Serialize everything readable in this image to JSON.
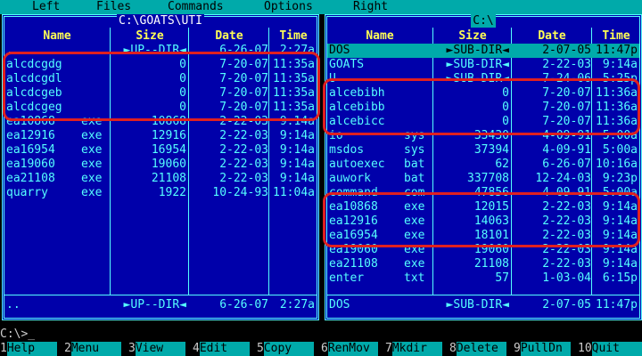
{
  "menu": [
    "Left",
    "Files",
    "Commands",
    "Options",
    "Right"
  ],
  "left_panel": {
    "title": "C:\\GOATS\\UTI",
    "headers": {
      "name": "Name",
      "size": "Size",
      "date": "Date",
      "time": "Time"
    },
    "rows": [
      {
        "name": "..",
        "ext": "",
        "size": "►UP--DIR◄",
        "date": "6-26-07",
        "time": "2:27a",
        "selected": false
      },
      {
        "name": "alcdcgdg",
        "ext": "",
        "size": "0",
        "date": "7-20-07",
        "time": "11:35a",
        "selected": false
      },
      {
        "name": "alcdcgdl",
        "ext": "",
        "size": "0",
        "date": "7-20-07",
        "time": "11:35a",
        "selected": false
      },
      {
        "name": "alcdcgeb",
        "ext": "",
        "size": "0",
        "date": "7-20-07",
        "time": "11:35a",
        "selected": false
      },
      {
        "name": "alcdcgeg",
        "ext": "",
        "size": "0",
        "date": "7-20-07",
        "time": "11:35a",
        "selected": false
      },
      {
        "name": "ea10868",
        "ext": "exe",
        "size": "10868",
        "date": "2-22-03",
        "time": "9:14a",
        "selected": false
      },
      {
        "name": "ea12916",
        "ext": "exe",
        "size": "12916",
        "date": "2-22-03",
        "time": "9:14a",
        "selected": false
      },
      {
        "name": "ea16954",
        "ext": "exe",
        "size": "16954",
        "date": "2-22-03",
        "time": "9:14a",
        "selected": false
      },
      {
        "name": "ea19060",
        "ext": "exe",
        "size": "19060",
        "date": "2-22-03",
        "time": "9:14a",
        "selected": false
      },
      {
        "name": "ea21108",
        "ext": "exe",
        "size": "21108",
        "date": "2-22-03",
        "time": "9:14a",
        "selected": false
      },
      {
        "name": "quarry",
        "ext": "exe",
        "size": "1922",
        "date": "10-24-93",
        "time": "11:04a",
        "selected": false
      }
    ],
    "status": {
      "name": "..",
      "size": "►UP--DIR◄",
      "date": "6-26-07",
      "time": "2:27a"
    }
  },
  "right_panel": {
    "title": "C:\\",
    "headers": {
      "name": "Name",
      "size": "Size",
      "date": "Date",
      "time": "Time"
    },
    "rows": [
      {
        "name": "DOS",
        "ext": "",
        "size": "►SUB-DIR◄",
        "date": "2-07-05",
        "time": "11:47p",
        "selected": true
      },
      {
        "name": "GOATS",
        "ext": "",
        "size": "►SUB-DIR◄",
        "date": "2-22-03",
        "time": "9:14a",
        "selected": false
      },
      {
        "name": "U",
        "ext": "",
        "size": "►SUB-DIR◄",
        "date": "7-24-06",
        "time": "5:25p",
        "selected": false
      },
      {
        "name": "alcebibh",
        "ext": "",
        "size": "0",
        "date": "7-20-07",
        "time": "11:36a",
        "selected": false
      },
      {
        "name": "alcebibb",
        "ext": "",
        "size": "0",
        "date": "7-20-07",
        "time": "11:36a",
        "selected": false
      },
      {
        "name": "alcebicc",
        "ext": "",
        "size": "0",
        "date": "7-20-07",
        "time": "11:36a",
        "selected": false
      },
      {
        "name": "io",
        "ext": "sys",
        "size": "33430",
        "date": "4-09-91",
        "time": "5:00a",
        "selected": false
      },
      {
        "name": "msdos",
        "ext": "sys",
        "size": "37394",
        "date": "4-09-91",
        "time": "5:00a",
        "selected": false
      },
      {
        "name": "autoexec",
        "ext": "bat",
        "size": "62",
        "date": "6-26-07",
        "time": "10:16a",
        "selected": false
      },
      {
        "name": "auwork",
        "ext": "bat",
        "size": "337708",
        "date": "12-24-03",
        "time": "9:23p",
        "selected": false
      },
      {
        "name": "command",
        "ext": "com",
        "size": "47856",
        "date": "4-09-91",
        "time": "5:00a",
        "selected": false
      },
      {
        "name": "ea10868",
        "ext": "exe",
        "size": "12015",
        "date": "2-22-03",
        "time": "9:14a",
        "selected": false
      },
      {
        "name": "ea12916",
        "ext": "exe",
        "size": "14063",
        "date": "2-22-03",
        "time": "9:14a",
        "selected": false
      },
      {
        "name": "ea16954",
        "ext": "exe",
        "size": "18101",
        "date": "2-22-03",
        "time": "9:14a",
        "selected": false
      },
      {
        "name": "ea19060",
        "ext": "exe",
        "size": "19060",
        "date": "2-22-03",
        "time": "9:14a",
        "selected": false
      },
      {
        "name": "ea21108",
        "ext": "exe",
        "size": "21108",
        "date": "2-22-03",
        "time": "9:14a",
        "selected": false
      },
      {
        "name": "enter",
        "ext": "txt",
        "size": "57",
        "date": "1-03-04",
        "time": "6:15p",
        "selected": false
      }
    ],
    "status": {
      "name": "DOS",
      "size": "►SUB-DIR◄",
      "date": "2-07-05",
      "time": "11:47p"
    }
  },
  "command_line": "C:\\>_",
  "fkeys": [
    {
      "num": "1",
      "label": "Help"
    },
    {
      "num": "2",
      "label": "Menu"
    },
    {
      "num": "3",
      "label": "View"
    },
    {
      "num": "4",
      "label": "Edit"
    },
    {
      "num": "5",
      "label": "Copy"
    },
    {
      "num": "6",
      "label": "RenMov"
    },
    {
      "num": "7",
      "label": "Mkdir"
    },
    {
      "num": "8",
      "label": "Delete"
    },
    {
      "num": "9",
      "label": "PullDn"
    },
    {
      "num": "10",
      "label": "Quit"
    }
  ],
  "colors": {
    "panel_bg": "#0000aa",
    "panel_fg": "#55ffff",
    "header_fg": "#ffff55",
    "highlight": "#e02020",
    "bar": "#00aaaa"
  }
}
